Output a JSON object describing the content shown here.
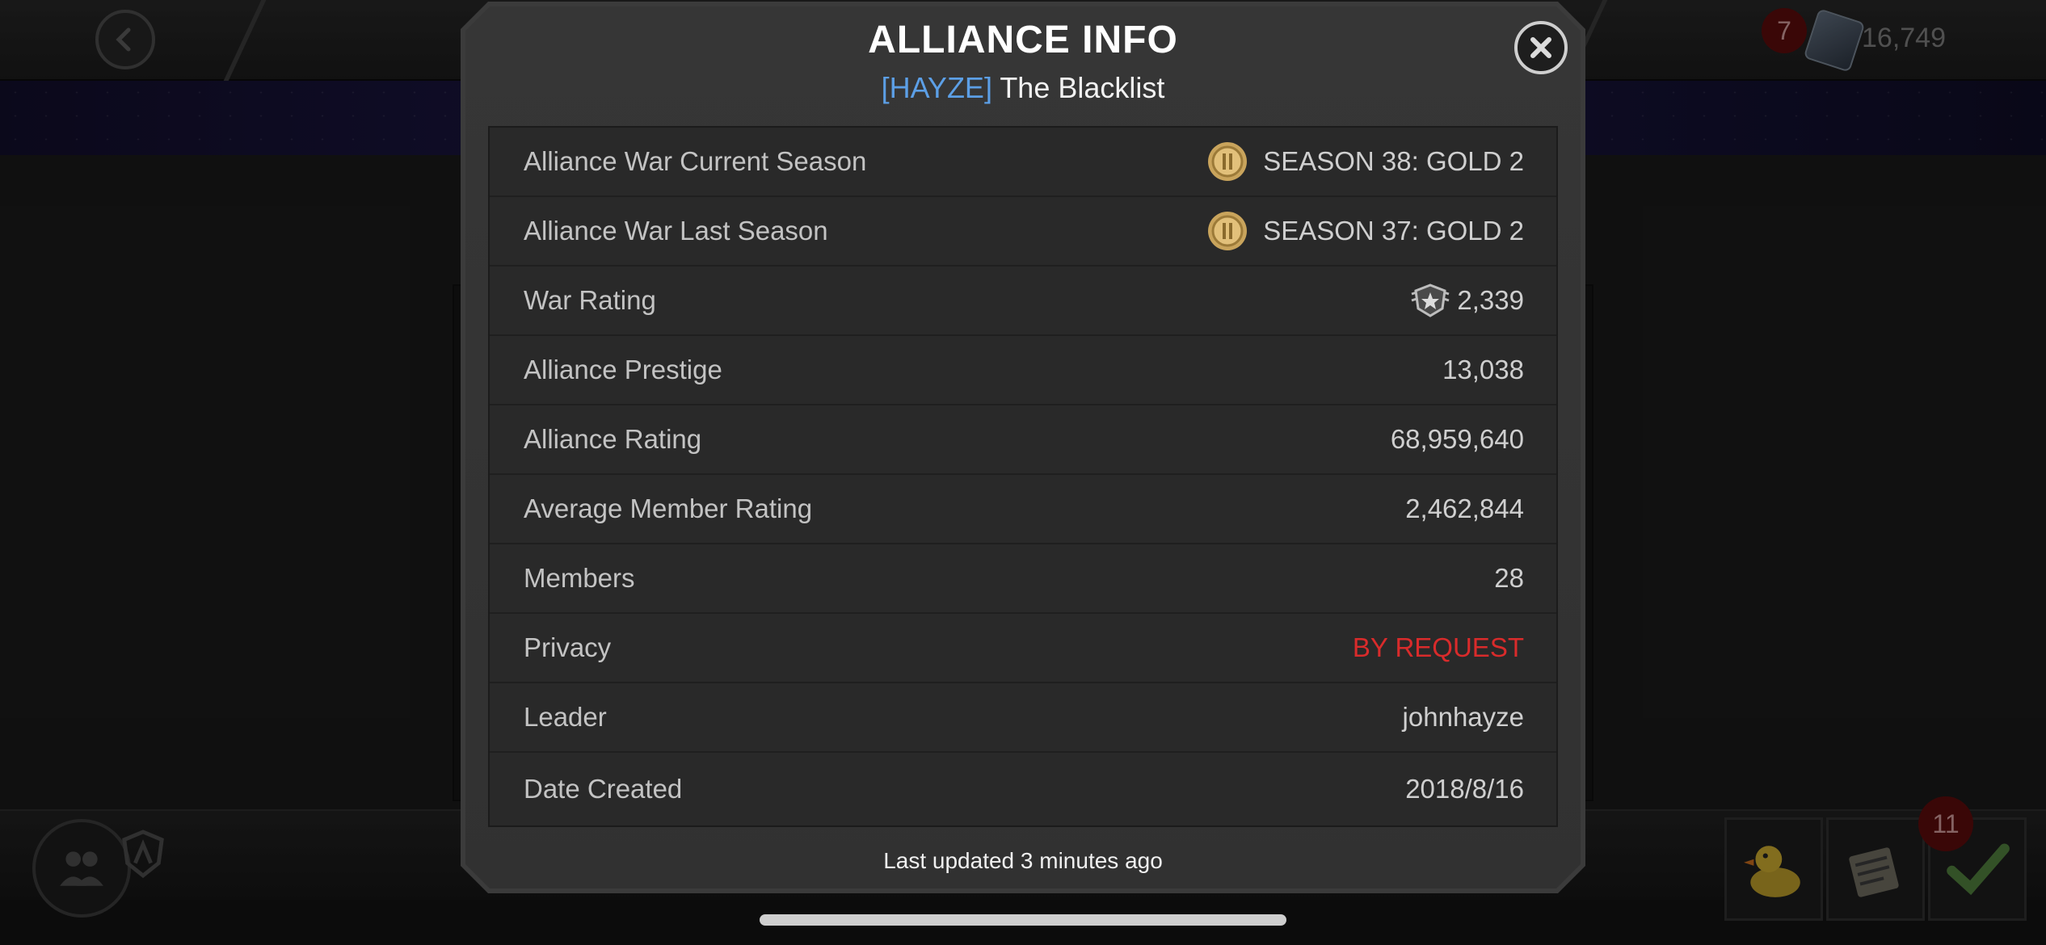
{
  "header": {
    "notification_count": "7",
    "currency_amount": "16,749"
  },
  "modal": {
    "title": "ALLIANCE INFO",
    "alliance_tag": "[HAYZE]",
    "alliance_name": "The Blacklist",
    "rows": [
      {
        "label": "Alliance War Current Season",
        "value": "SEASON 38: GOLD 2",
        "icon": "gold-medal-icon"
      },
      {
        "label": "Alliance War Last Season",
        "value": "SEASON 37: GOLD 2",
        "icon": "gold-medal-icon"
      },
      {
        "label": "War Rating",
        "value": "2,339",
        "icon": "war-rating-icon"
      },
      {
        "label": "Alliance Prestige",
        "value": "13,038"
      },
      {
        "label": "Alliance Rating",
        "value": "68,959,640"
      },
      {
        "label": "Average Member Rating",
        "value": "2,462,844"
      },
      {
        "label": "Members",
        "value": "28"
      },
      {
        "label": "Privacy",
        "value": "BY REQUEST",
        "color": "#d92b2b"
      },
      {
        "label": "Leader",
        "value": "johnhayze"
      },
      {
        "label": "Date Created",
        "value": "2018/8/16"
      }
    ],
    "footer": "Last updated 3 minutes ago"
  },
  "bottom_bar": {
    "tile_badge_count": "11"
  },
  "colors": {
    "accent_blue": "#5c9fe6",
    "privacy_red": "#d92b2b",
    "medal_gold": "#c9a45c"
  }
}
